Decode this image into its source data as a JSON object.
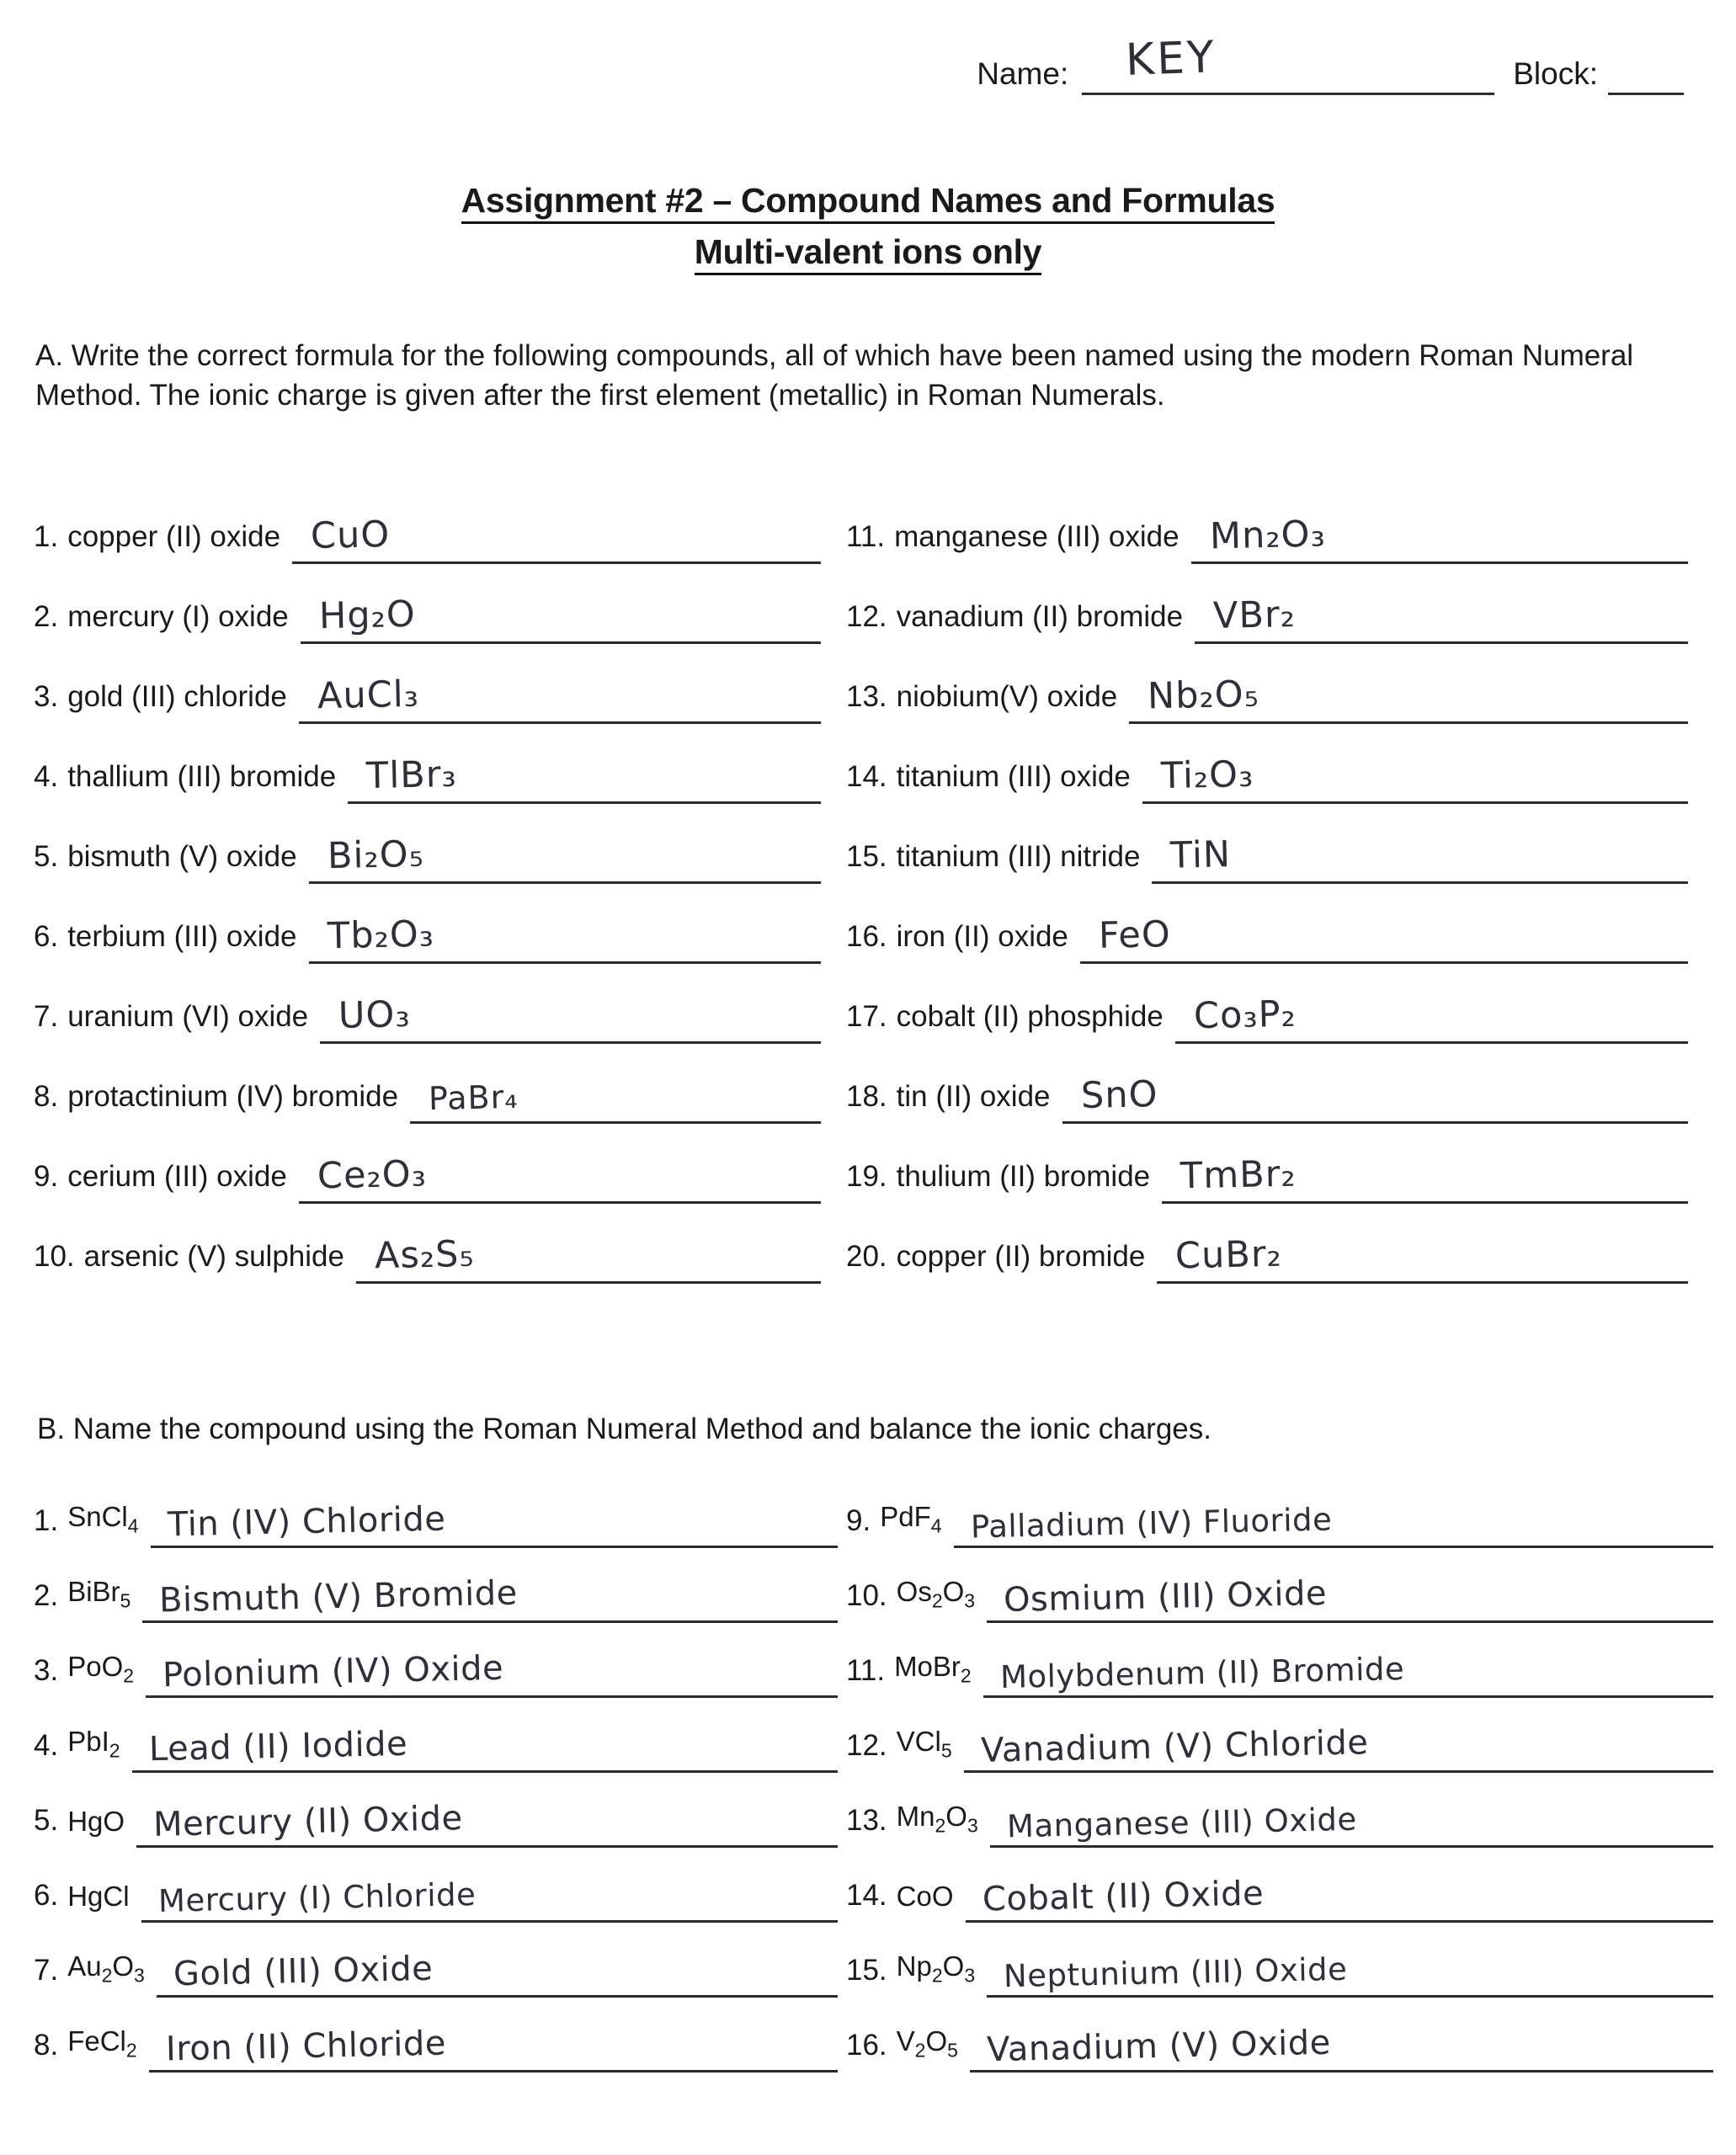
{
  "header": {
    "name_label": "Name:",
    "name_value": "KEY",
    "block_label": "Block:",
    "block_value": ""
  },
  "title": {
    "line1": "Assignment #2 – Compound Names and Formulas",
    "line2": "Multi-valent ions only"
  },
  "instructions": {
    "part_a": "A.  Write the correct formula for the following compounds, all of which have been named using the modern Roman Numeral Method.  The ionic charge is given after the first element (metallic) in Roman Numerals.",
    "part_b": "B.  Name the compound using the Roman Numeral Method and balance the ionic charges."
  },
  "part_a": {
    "left": [
      {
        "num": "1.",
        "name": "copper (II) oxide",
        "answer": "CuO"
      },
      {
        "num": "2.",
        "name": "mercury (I) oxide",
        "answer": "Hg₂O"
      },
      {
        "num": "3.",
        "name": "gold (III) chloride",
        "answer": "AuCl₃"
      },
      {
        "num": "4.",
        "name": "thallium (III) bromide",
        "answer": "TlBr₃"
      },
      {
        "num": "5.",
        "name": "bismuth (V) oxide",
        "answer": "Bi₂O₅"
      },
      {
        "num": "6.",
        "name": "terbium (III) oxide",
        "answer": "Tb₂O₃"
      },
      {
        "num": "7.",
        "name": "uranium (VI) oxide",
        "answer": "UO₃"
      },
      {
        "num": "8.",
        "name": "protactinium (IV) bromide",
        "answer": "PaBr₄"
      },
      {
        "num": "9.",
        "name": "cerium (III) oxide",
        "answer": "Ce₂O₃"
      },
      {
        "num": "10.",
        "name": "arsenic (V) sulphide",
        "answer": "As₂S₅"
      }
    ],
    "right": [
      {
        "num": "11.",
        "name": "manganese (III) oxide",
        "answer": "Mn₂O₃"
      },
      {
        "num": "12.",
        "name": "vanadium (II) bromide",
        "answer": "VBr₂"
      },
      {
        "num": "13.",
        "name": "niobium(V) oxide",
        "answer": "Nb₂O₅"
      },
      {
        "num": "14.",
        "name": "titanium (III) oxide",
        "answer": "Ti₂O₃"
      },
      {
        "num": "15.",
        "name": "titanium (III) nitride",
        "answer": "TiN"
      },
      {
        "num": "16.",
        "name": "iron (II) oxide",
        "answer": "FeO"
      },
      {
        "num": "17.",
        "name": "cobalt (II) phosphide",
        "answer": "Co₃P₂"
      },
      {
        "num": "18.",
        "name": "tin (II) oxide",
        "answer": "SnO"
      },
      {
        "num": "19.",
        "name": "thulium (II) bromide",
        "answer": "TmBr₂"
      },
      {
        "num": "20.",
        "name": "copper (II) bromide",
        "answer": "CuBr₂"
      }
    ]
  },
  "part_b": {
    "left": [
      {
        "num": "1.",
        "formula": "SnCl<sub>4</sub>",
        "answer": "Tin (IV) Chloride"
      },
      {
        "num": "2.",
        "formula": "BiBr<sub>5</sub>",
        "answer": "Bismuth (V) Bromide"
      },
      {
        "num": "3.",
        "formula": "PoO<sub>2</sub>",
        "answer": "Polonium (IV) Oxide"
      },
      {
        "num": "4.",
        "formula": "PbI<sub>2</sub>",
        "answer": "Lead (II) Iodide"
      },
      {
        "num": "5.",
        "formula": "HgO",
        "answer": "Mercury (II) Oxide"
      },
      {
        "num": "6.",
        "formula": "HgCl",
        "answer": "Mercury (I) Chloride"
      },
      {
        "num": "7.",
        "formula": "Au<sub>2</sub>O<sub>3</sub>",
        "answer": "Gold (III) Oxide"
      },
      {
        "num": "8.",
        "formula": "FeCl<sub>2</sub>",
        "answer": "Iron (II) Chloride"
      }
    ],
    "right": [
      {
        "num": "9.",
        "formula": "PdF<sub>4</sub>",
        "answer": "Palladium (IV) Fluoride"
      },
      {
        "num": "10.",
        "formula": "Os<sub>2</sub>O<sub>3</sub>",
        "answer": "Osmium (III) Oxide"
      },
      {
        "num": "11.",
        "formula": "MoBr<sub>2</sub>",
        "answer": "Molybdenum (II) Bromide"
      },
      {
        "num": "12.",
        "formula": "VCl<sub>5</sub>",
        "answer": "Vanadium (V) Chloride"
      },
      {
        "num": "13.",
        "formula": "Mn<sub>2</sub>O<sub>3</sub>",
        "answer": "Manganese (III) Oxide"
      },
      {
        "num": "14.",
        "formula": "CoO",
        "answer": "Cobalt (II) Oxide"
      },
      {
        "num": "15.",
        "formula": "Np<sub>2</sub>O<sub>3</sub>",
        "answer": "Neptunium (III) Oxide"
      },
      {
        "num": "16.",
        "formula": "V<sub>2</sub>O<sub>5</sub>",
        "answer": "Vanadium (V) Oxide"
      }
    ]
  }
}
